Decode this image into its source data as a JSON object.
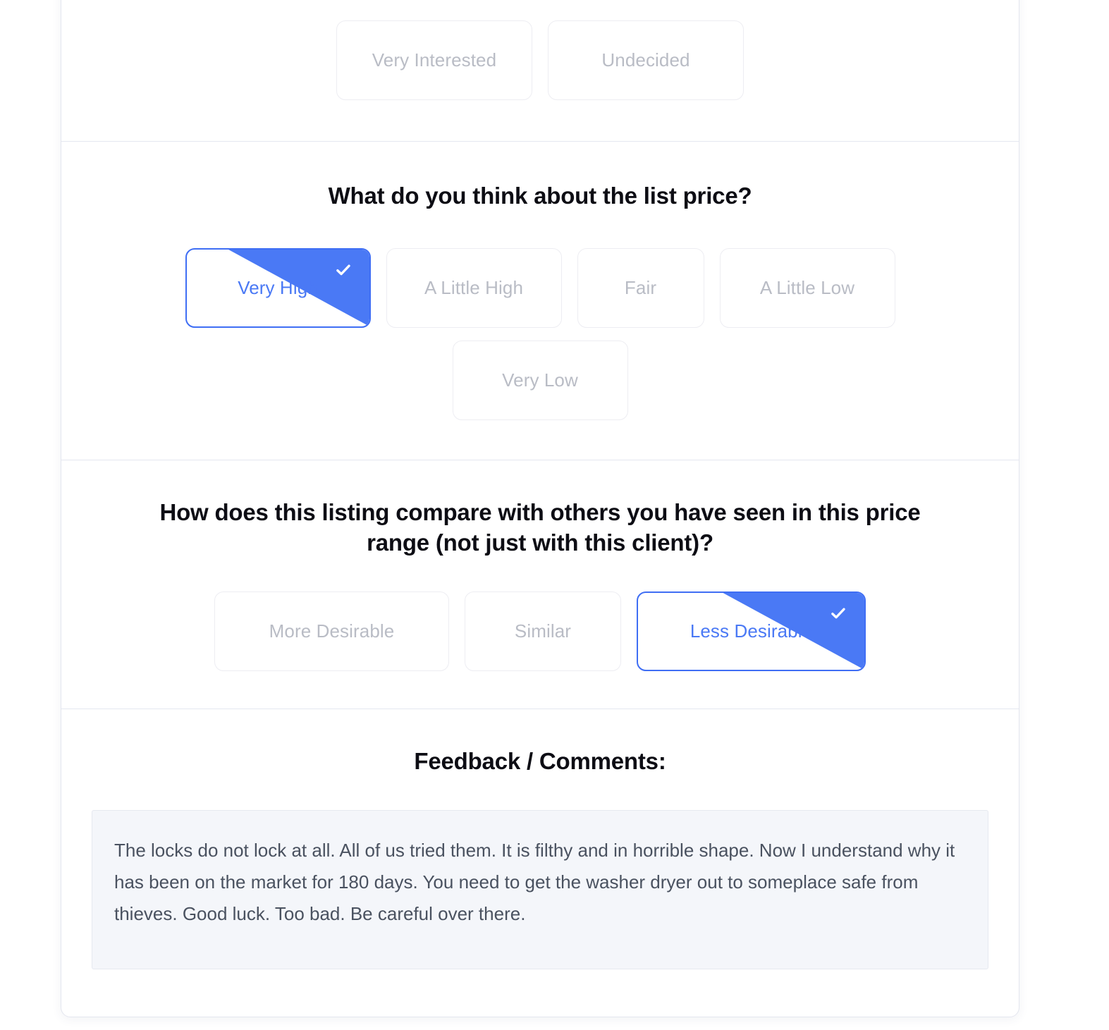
{
  "survey": {
    "sections": [
      {
        "id": "interest",
        "title": "",
        "options": [
          {
            "label": "Very Interested",
            "selected": false
          },
          {
            "label": "Undecided",
            "selected": false
          }
        ]
      },
      {
        "id": "price",
        "title": "What do you think about the list price?",
        "options": [
          {
            "label": "Very High",
            "selected": true
          },
          {
            "label": "A Little High",
            "selected": false
          },
          {
            "label": "Fair",
            "selected": false
          },
          {
            "label": "A Little Low",
            "selected": false
          },
          {
            "label": "Very Low",
            "selected": false
          }
        ]
      },
      {
        "id": "compare",
        "title": "How does this listing compare with others you have seen in this price range (not just with this client)?",
        "options": [
          {
            "label": "More Desirable",
            "selected": false
          },
          {
            "label": "Similar",
            "selected": false
          },
          {
            "label": "Less Desirable",
            "selected": true
          }
        ]
      },
      {
        "id": "feedback",
        "title": "Feedback / Comments:",
        "comment": "The locks do not lock at all. All of us tried them. It is filthy and in horrible shape. Now I understand why it has been on the market for 180 days. You need to get the washer dryer out to someplace safe from thieves. Good luck. Too bad. Be careful over there."
      }
    ]
  },
  "colors": {
    "accent": "#3f6ef4",
    "check_flag": "#4a79f5",
    "selected_text": "#4a79f5",
    "option_text": "#b9bcc5",
    "heading_text": "#0d0d14",
    "feedback_bg": "#f4f6fa",
    "feedback_text": "#4a5260",
    "divider": "#e4e7f0"
  },
  "icons": {
    "check": "check-icon"
  }
}
